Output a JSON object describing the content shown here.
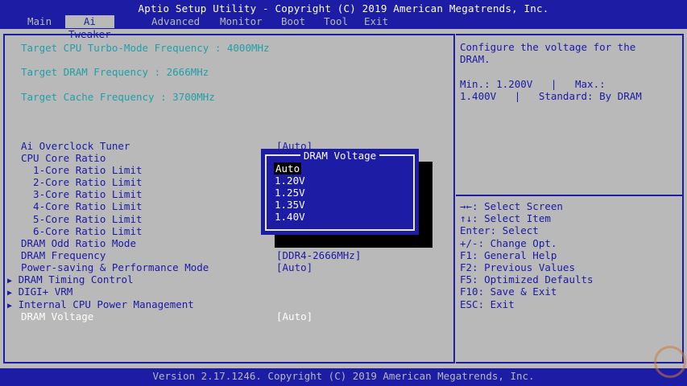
{
  "title": "Aptio Setup Utility - Copyright (C) 2019 American Megatrends, Inc.",
  "menu": [
    "Main",
    "Ai Tweaker",
    "Advanced",
    "Monitor",
    "Boot",
    "Tool",
    "Exit"
  ],
  "targets": [
    "Target CPU Turbo-Mode Frequency : 4000MHz",
    "Target DRAM Frequency : 2666MHz",
    "Target Cache Frequency : 3700MHz"
  ],
  "settings": [
    {
      "label": "Ai Overclock Tuner",
      "value": "[Auto]"
    },
    {
      "label": "CPU Core Ratio",
      "value": ""
    },
    {
      "label": "  1-Core Ratio Limit",
      "value": ""
    },
    {
      "label": "  2-Core Ratio Limit",
      "value": ""
    },
    {
      "label": "  3-Core Ratio Limit",
      "value": ""
    },
    {
      "label": "  4-Core Ratio Limit",
      "value": ""
    },
    {
      "label": "  5-Core Ratio Limit",
      "value": ""
    },
    {
      "label": "  6-Core Ratio Limit",
      "value": ""
    },
    {
      "label": "DRAM Odd Ratio Mode",
      "value": ""
    },
    {
      "label": "DRAM Frequency",
      "value": "[DDR4-2666MHz]"
    },
    {
      "label": "Power-saving & Performance Mode",
      "value": "[Auto]"
    },
    {
      "label": "DRAM Timing Control",
      "value": ""
    },
    {
      "label": "DIGI+ VRM",
      "value": ""
    },
    {
      "label": "Internal CPU Power Management",
      "value": ""
    },
    {
      "label": "DRAM Voltage",
      "value": "[Auto]"
    }
  ],
  "help": {
    "description": "Configure the voltage for the\nDRAM.\n\nMin.: 1.200V   |   Max.:\n1.400V   |   Standard: By DRAM",
    "keys": "→←: Select Screen\n↑↓: Select Item\nEnter: Select\n+/-: Change Opt.\nF1: General Help\nF2: Previous Values\nF5: Optimized Defaults\nF10: Save & Exit\nESC: Exit"
  },
  "popup": {
    "title": "DRAM Voltage",
    "options": [
      "Auto",
      "1.20V",
      "1.25V",
      "1.35V",
      "1.40V"
    ],
    "selected": "Auto"
  },
  "footer": "Version 2.17.1246. Copyright (C) 2019 American Megatrends, Inc.",
  "colors": {
    "background": "#b9b9b9",
    "accent": "#1c1ca4",
    "cyan": "#20a0a8"
  }
}
